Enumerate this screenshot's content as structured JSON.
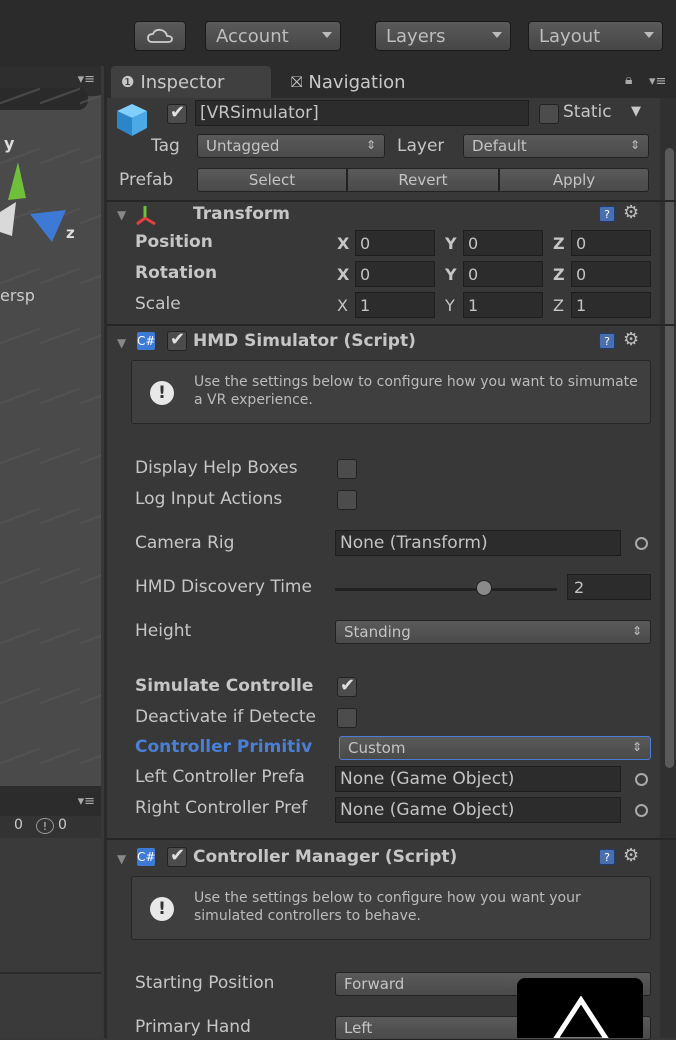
{
  "toolbar": {
    "cloud_icon": "cloud-icon",
    "account_label": "Account",
    "layers_label": "Layers",
    "layout_label": "Layout"
  },
  "scene": {
    "axis_label_y": "y",
    "axis_label_z": "z",
    "persp_label": "ersp",
    "console_counts": [
      "0",
      "0"
    ]
  },
  "tabs": {
    "inspector": "Inspector",
    "navigation": "Navigation"
  },
  "object": {
    "name": "[VRSimulator]",
    "static_label": "Static",
    "tag_label": "Tag",
    "tag_value": "Untagged",
    "layer_label": "Layer",
    "layer_value": "Default",
    "prefab_label": "Prefab",
    "select_label": "Select",
    "revert_label": "Revert",
    "apply_label": "Apply"
  },
  "transform": {
    "title": "Transform",
    "position_label": "Position",
    "rotation_label": "Rotation",
    "scale_label": "Scale",
    "axes": [
      "X",
      "Y",
      "Z"
    ],
    "position": [
      "0",
      "0",
      "0"
    ],
    "rotation": [
      "0",
      "0",
      "0"
    ],
    "scale": [
      "1",
      "1",
      "1"
    ]
  },
  "hmd": {
    "title": "HMD Simulator (Script)",
    "help": "Use the settings below to configure how you want to simumate a VR experience.",
    "display_help_label": "Display Help Boxes",
    "log_input_label": "Log Input Actions",
    "camera_rig_label": "Camera Rig",
    "camera_rig_value": "None (Transform)",
    "discovery_label": "HMD Discovery Time",
    "discovery_value": "2",
    "discovery_fraction": 0.67,
    "height_label": "Height",
    "height_value": "Standing",
    "simulate_label": "Simulate Controlle",
    "deactivate_label": "Deactivate if Detecte",
    "primitive_label": "Controller Primitiv",
    "primitive_value": "Custom",
    "left_prefab_label": "Left Controller Prefa",
    "left_prefab_value": "None (Game Object)",
    "right_prefab_label": "Right Controller Pref",
    "right_prefab_value": "None (Game Object)"
  },
  "controller": {
    "title": "Controller Manager (Script)",
    "help": "Use the settings below to configure how you want your simulated controllers to behave.",
    "starting_label": "Starting Position",
    "starting_value": "Forward",
    "primary_label": "Primary Hand",
    "primary_value": "Left"
  },
  "colors": {
    "accent": "#4a7fd6",
    "panel": "#383838"
  }
}
